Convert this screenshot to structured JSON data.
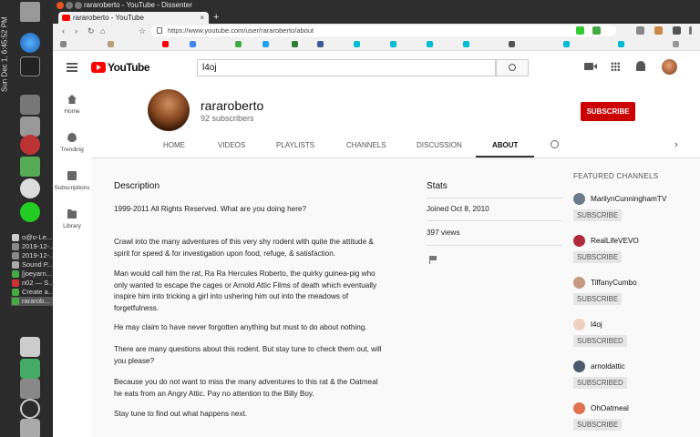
{
  "system": {
    "clock": "Sun Dec 1, 6:45:52 PM",
    "taskbar": [
      "o@o-Le...",
      "2019-12-...",
      "2019-12-...",
      "Sound P...",
      "[joeyarn...",
      "n02 — S...",
      "Create a...",
      "rararob..."
    ]
  },
  "browser": {
    "window_title": "rararoberto - YouTube - Dissenter",
    "tab_title": "rararoberto - YouTube",
    "tab_close": "×",
    "new_tab": "+",
    "url": "https://www.youtube.com/user/rararoberto/about",
    "nav": {
      "back": "‹",
      "forward": "›",
      "reload": "↻",
      "home": "⌂",
      "star": "☆"
    }
  },
  "youtube": {
    "logo_text": "YouTube",
    "search_value": "l4oj",
    "sidebar": [
      {
        "label": "Home",
        "icon": "home-icon"
      },
      {
        "label": "Trending",
        "icon": "trending-icon"
      },
      {
        "label": "Subscriptions",
        "icon": "subscriptions-icon"
      },
      {
        "label": "Library",
        "icon": "library-icon"
      }
    ],
    "channel": {
      "name": "rararoberto",
      "subscribers": "92 subscribers",
      "subscribe_label": "SUBSCRIBE",
      "tabs": [
        "HOME",
        "VIDEOS",
        "PLAYLISTS",
        "CHANNELS",
        "DISCUSSION",
        "ABOUT"
      ],
      "active_tab": "ABOUT",
      "next_arrow": "›"
    },
    "about": {
      "description_heading": "Description",
      "paragraphs": [
        "1999-2011 All Rights Reserved. What are you doing here?",
        "Crawl into the many adventures of this very shy rodent with quite the attitude & spirit for speed & for investigation upon food, refuge, & satisfaction.",
        "Man would call him the rat, Ra Ra Hercules Roberto, the quirky guinea-pig who only wanted to escape the cages or Arnold Attic Films of death which eventually inspire him into tricking a girl into ushering him out into the meadows of forgetfulness.",
        "He may claim to have never forgotten anything but must to do about nothing.",
        "There are many questions about this rodent. But stay tune to check them out, will you please?",
        "Because you do not want to miss the many adventures to this rat & the Oatmeal he eats from an Angry Attic. Pay no attention to the Billy Boy.",
        "Stay tune to find out what happens next."
      ],
      "stats_heading": "Stats",
      "joined": "Joined Oct 8, 2010",
      "views": "397 views"
    },
    "featured": {
      "heading": "FEATURED CHANNELS",
      "channels": [
        {
          "name": "MarilynCunninghamTV",
          "button": "SUBSCRIBE",
          "color": "#6a7a8a"
        },
        {
          "name": "RealLifeVEVO",
          "button": "SUBSCRIBE",
          "color": "#b02a3a"
        },
        {
          "name": "TiffanyCumbo",
          "button": "SUBSCRIBE",
          "color": "#c49a80"
        },
        {
          "name": "l4oj",
          "button": "SUBSCRIBED",
          "color": "#f0d0c0"
        },
        {
          "name": "arnoldattic",
          "button": "SUBSCRIBED",
          "color": "#4a5a6a"
        },
        {
          "name": "OhOatmeal",
          "button": "SUBSCRIBE",
          "color": "#e07050"
        }
      ]
    }
  }
}
